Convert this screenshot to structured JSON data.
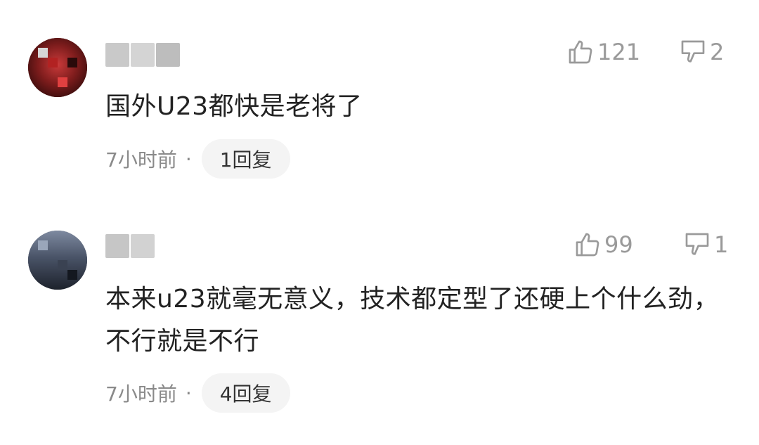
{
  "comments": [
    {
      "text": "国外U23都快是老将了",
      "time": "7小时前",
      "separator": "·",
      "reply_label": "1回复",
      "likes": "121",
      "dislikes": "2"
    },
    {
      "text": "本来u23就毫无意义，技术都定型了还硬上个什么劲，不行就是不行",
      "time": "7小时前",
      "separator": "·",
      "reply_label": "4回复",
      "likes": "99",
      "dislikes": "1"
    }
  ],
  "icons": {
    "like": "thumbs-up-icon",
    "dislike": "thumbs-down-icon"
  },
  "colors": {
    "text_primary": "#222222",
    "text_secondary": "#8a8a8a",
    "reply_bg": "#f4f4f4"
  }
}
